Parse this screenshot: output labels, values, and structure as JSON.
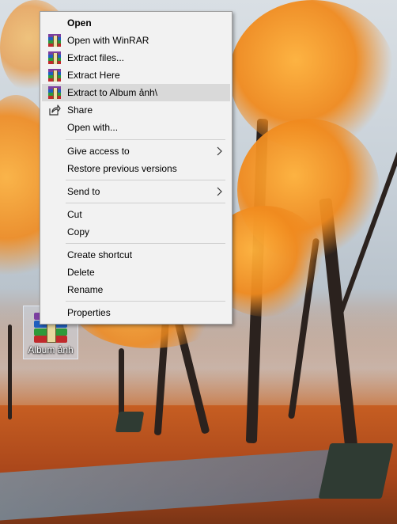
{
  "context_menu": {
    "items": [
      {
        "label": "Open"
      },
      {
        "label": "Open with WinRAR",
        "icon": "winrar-icon"
      },
      {
        "label": "Extract files...",
        "icon": "winrar-icon"
      },
      {
        "label": "Extract Here",
        "icon": "winrar-icon"
      },
      {
        "label": "Extract to Album ảnh\\",
        "icon": "winrar-icon"
      },
      {
        "label": "Share",
        "icon": "share-icon"
      },
      {
        "label": "Open with..."
      },
      {
        "label": "Give access to",
        "icon": "chevron-right-icon"
      },
      {
        "label": "Restore previous versions"
      },
      {
        "label": "Send to",
        "icon": "chevron-right-icon"
      },
      {
        "label": "Cut"
      },
      {
        "label": "Copy"
      },
      {
        "label": "Create shortcut"
      },
      {
        "label": "Delete"
      },
      {
        "label": "Rename"
      },
      {
        "label": "Properties"
      }
    ]
  },
  "desktop": {
    "icon_label": "Album ảnh",
    "icon": "winrar-archive-icon"
  },
  "colors": {
    "menu_background": "#f2f2f2",
    "menu_highlight": "#d9d9d9",
    "rar_band_purple": "#7b3fa0",
    "rar_band_blue": "#1f5fbf",
    "rar_band_green": "#2e9a3a",
    "rar_band_red": "#c0292b"
  }
}
